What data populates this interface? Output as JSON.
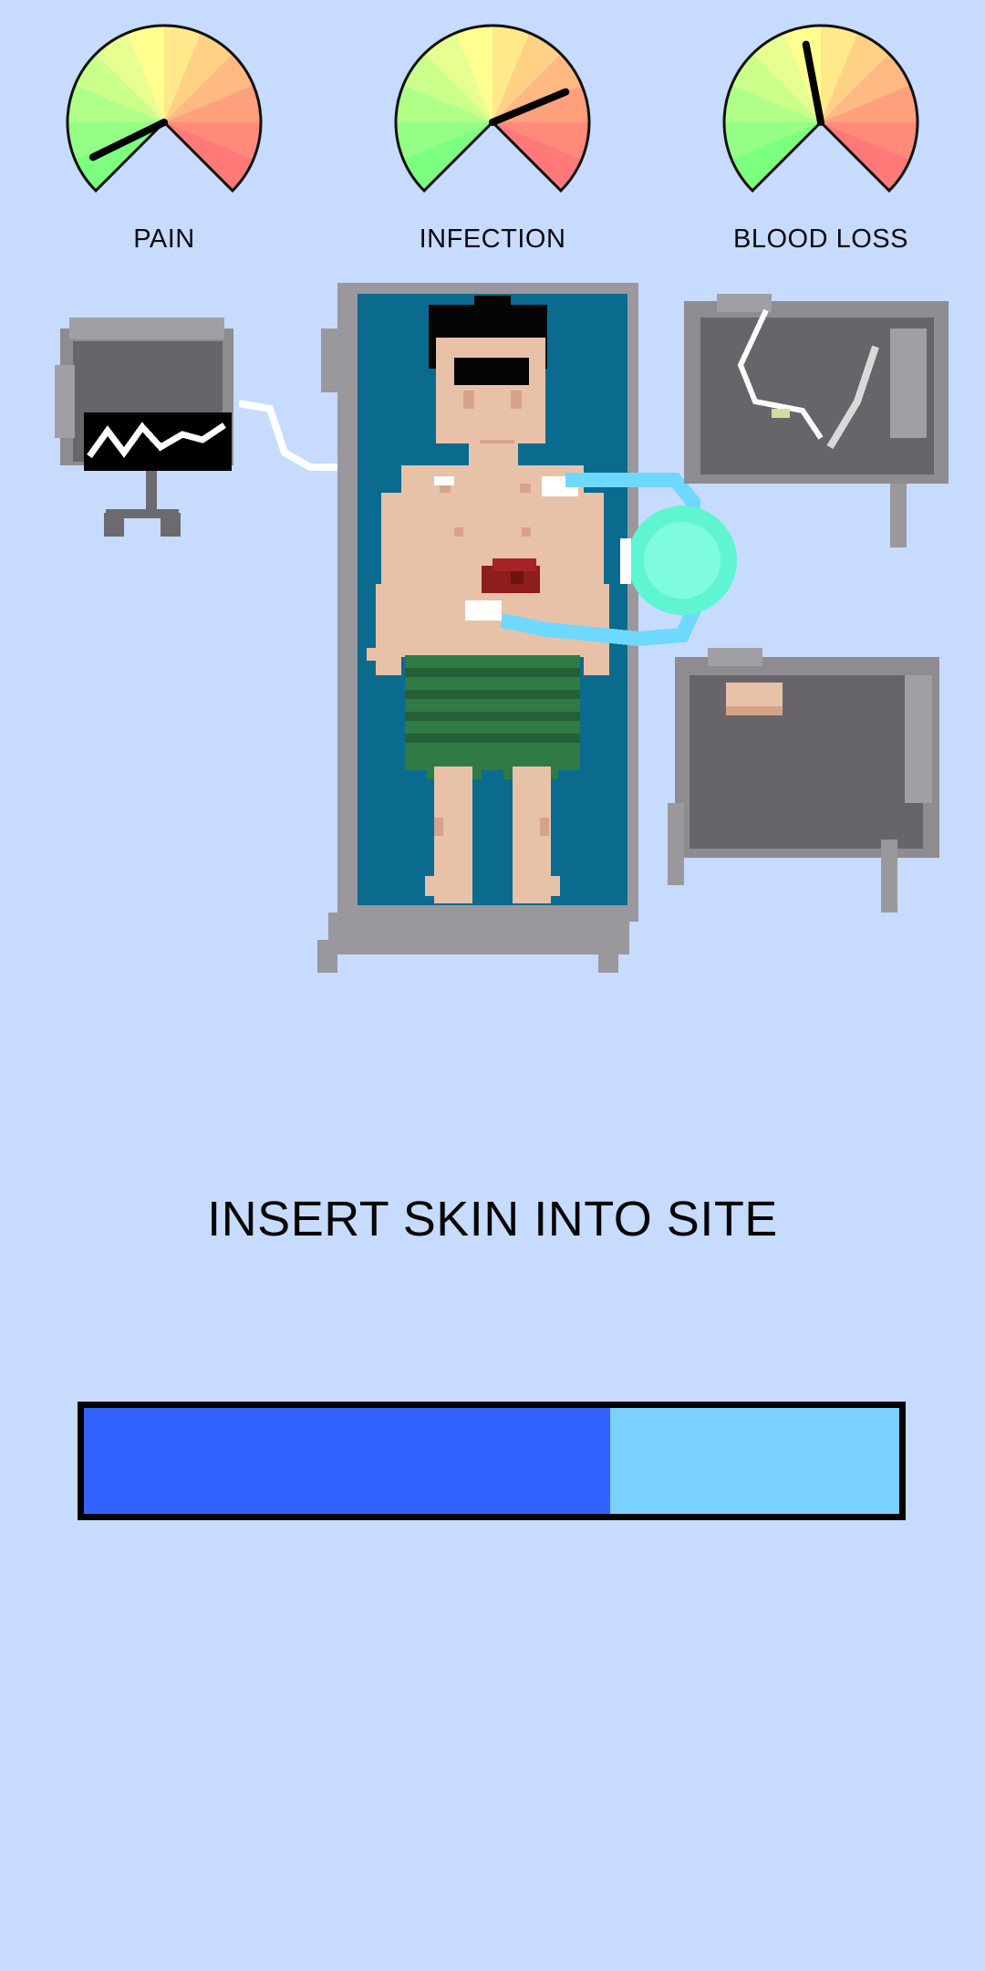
{
  "gauges": [
    {
      "id": "pain",
      "label": "PAIN",
      "value": 0.07
    },
    {
      "id": "infection",
      "label": "INFECTION",
      "value": 0.75
    },
    {
      "id": "bloodloss",
      "label": "BLOOD LOSS",
      "value": 0.46
    }
  ],
  "instruction": "INSERT SKIN INTO SITE",
  "progress": {
    "value": 0.645,
    "fill_color": "#3262ff",
    "track_color": "#7ad0ff"
  },
  "scene": {
    "patient": "patient-on-operating-table",
    "wound": "wound-site",
    "heart_monitor": "heart-monitor",
    "tool_tray_top": "scalpel-tray",
    "tool_tray_bottom": "skin-graft-tray",
    "skin_graft": "skin-graft-piece"
  },
  "colors": {
    "background": "#c7dbff",
    "table": "#0a6b8f",
    "energy_orb": "#5ff5d2"
  }
}
